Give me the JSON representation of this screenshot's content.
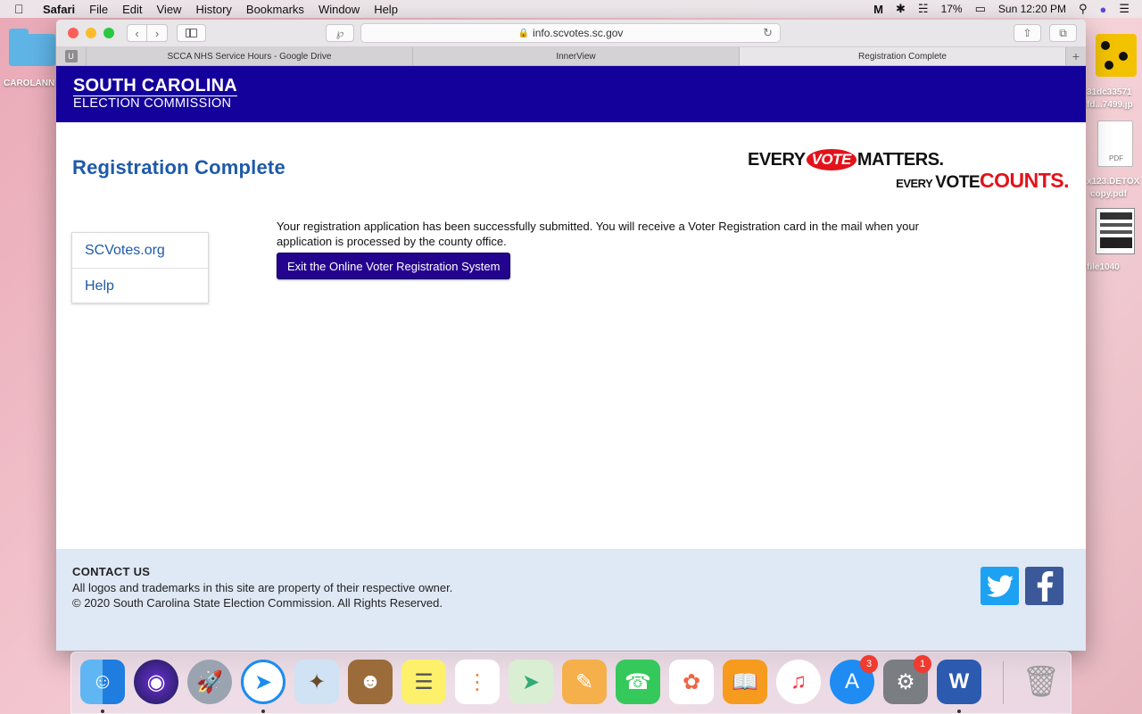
{
  "menubar": {
    "app": "Safari",
    "items": [
      "File",
      "Edit",
      "View",
      "History",
      "Bookmarks",
      "Window",
      "Help"
    ],
    "battery": "17%",
    "clock": "Sun 12:20 PM"
  },
  "desktop": {
    "folder_label": "CAROLANN",
    "right_labels": [
      "31dc33571",
      "fd...7499.jp",
      "PDF",
      "x123.DETOX",
      "copy.pdf",
      "file1040"
    ]
  },
  "browser": {
    "url": "info.scvotes.sc.gov",
    "pinned_tab": "U",
    "tabs": [
      {
        "label": "SCCA NHS Service Hours - Google Drive"
      },
      {
        "label": "InnerView"
      },
      {
        "label": "Registration Complete"
      }
    ]
  },
  "site": {
    "logo_line1": "SOUTH CAROLINA",
    "logo_line2": "ELECTION COMMISSION",
    "page_title": "Registration Complete",
    "slogan": {
      "every": "EVERY",
      "vote": "VOTE",
      "matters": "MATTERS.",
      "every2": "EVERY",
      "vote2": "VOTE",
      "counts": "COUNTS."
    },
    "nav": [
      {
        "label": "SCVotes.org"
      },
      {
        "label": "Help"
      }
    ],
    "message": "Your registration application has been successfully submitted. You will receive a Voter Registration card in the mail when your application is processed by the county office.",
    "exit_button": "Exit the Online Voter Registration System",
    "footer": {
      "contact": "CONTACT US",
      "line1": "All logos and trademarks in this site are property of their respective owner.",
      "line2": "© 2020 South Carolina State Election Commission. All Rights Reserved."
    }
  },
  "dock": {
    "appstore_badge": "3",
    "prefs_badge": "1"
  }
}
